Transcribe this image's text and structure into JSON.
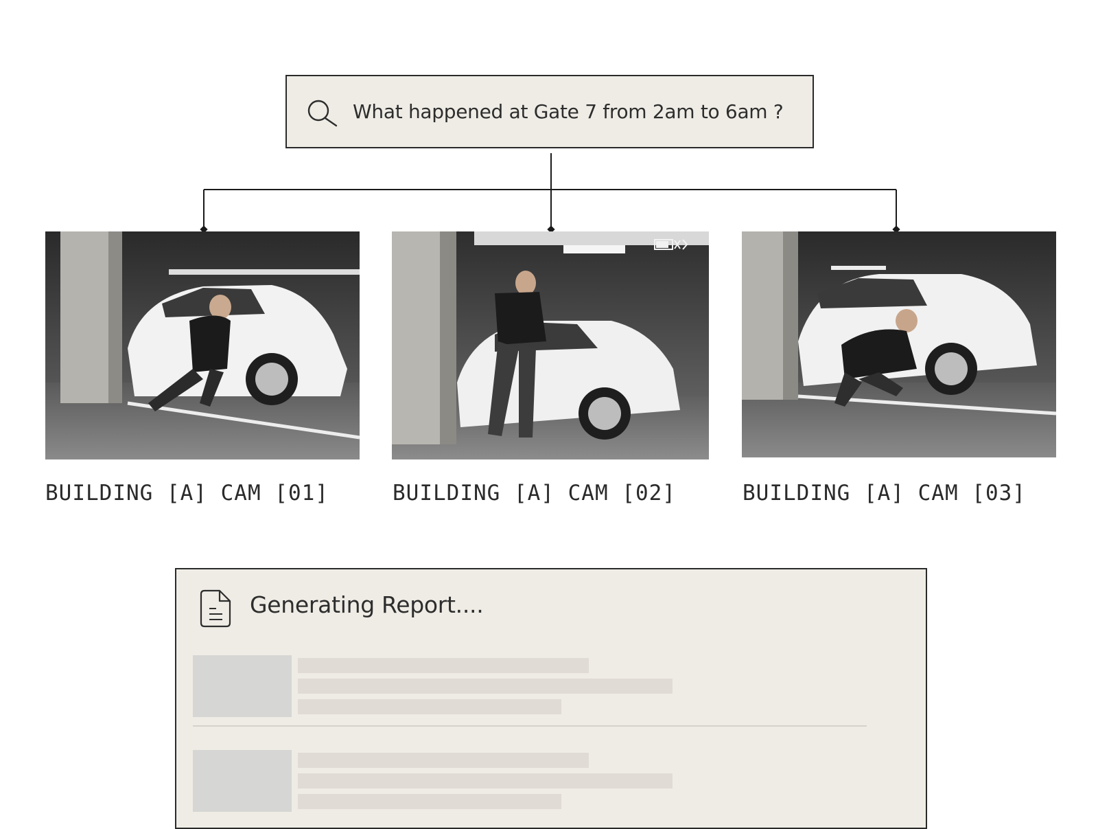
{
  "search": {
    "query": "What happened at Gate 7 from 2am to 6am ?",
    "icon": "search-icon"
  },
  "cameras": [
    {
      "label": "BUILDING [A] CAM [01]"
    },
    {
      "label": "BUILDING [A] CAM [02]",
      "status_icon": "battery-disconnected-icon"
    },
    {
      "label": "BUILDING [A] CAM [03]"
    }
  ],
  "report": {
    "title": "Generating Report....",
    "icon": "document-icon",
    "loading": true
  },
  "colors": {
    "panel_bg": "#efece5",
    "border": "#2a2a2a",
    "text": "#2d2d2d",
    "skeleton_thumb": "#d6d6d4",
    "skeleton_line": "#e0dcd5"
  }
}
